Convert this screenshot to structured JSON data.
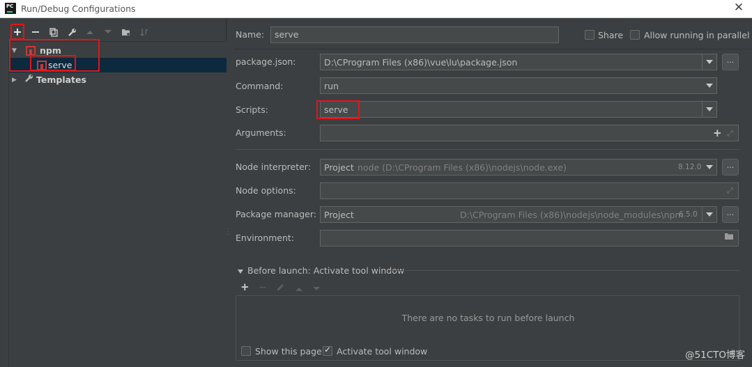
{
  "window": {
    "title": "Run/Debug Configurations",
    "app_icon_text": "PC"
  },
  "toolbar": {
    "add": "add-icon",
    "remove": "minus-icon",
    "copy": "copy-icon",
    "edit_defaults": "wrench-icon",
    "move_up": "arrow-up-icon",
    "move_down": "arrow-down-icon",
    "folder": "new-folder-icon",
    "sort": "sort-icon"
  },
  "tree": {
    "npm_label": "npm",
    "serve_label": "serve",
    "templates_label": "Templates"
  },
  "form": {
    "name_label": "Name:",
    "name_value": "serve",
    "share_label": "Share",
    "allow_parallel_label": "Allow running in parallel",
    "package_json_label": "package.json:",
    "package_json_value": "D:\\CProgram Files (x86)\\vue\\lu\\package.json",
    "command_label": "Command:",
    "command_value": "run",
    "scripts_label": "Scripts:",
    "scripts_value": "serve",
    "arguments_label": "Arguments:",
    "arguments_value": "",
    "node_interpreter_label": "Node interpreter:",
    "node_interpreter_prefix": "Project",
    "node_interpreter_path": "node (D:\\CProgram Files (x86)\\nodejs\\node.exe)",
    "node_interpreter_version": "8.12.0",
    "node_options_label": "Node options:",
    "node_options_value": "",
    "package_manager_label": "Package manager:",
    "package_manager_prefix": "Project",
    "package_manager_path": "D:\\CProgram Files (x86)\\nodejs\\node_modules\\npm",
    "package_manager_version": "6.5.0",
    "environment_label": "Environment:",
    "environment_value": "",
    "browse_label": "..."
  },
  "before_launch": {
    "header": "Before launch: Activate tool window",
    "empty_text": "There are no tasks to run before launch",
    "show_page_label": "Show this page",
    "show_page_checked": false,
    "activate_label": "Activate tool window",
    "activate_checked": true
  },
  "watermark": "@51CTO博客",
  "colors": {
    "highlight_box": "#e0161b",
    "selection": "#0d293e",
    "npm_red": "#cb3837"
  }
}
